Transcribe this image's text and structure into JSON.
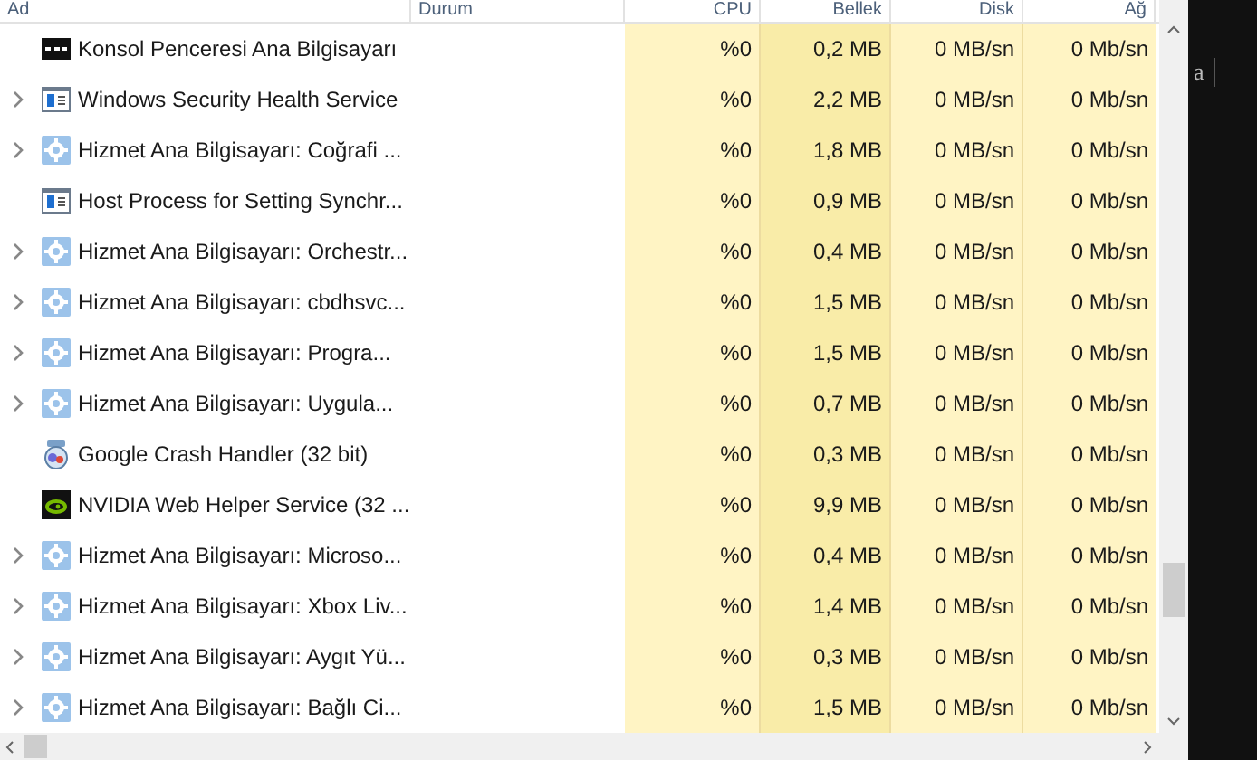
{
  "columns": [
    "Ad",
    "Durum",
    "CPU",
    "Bellek",
    "Disk",
    "Ağ"
  ],
  "rows": [
    {
      "kind": "console",
      "expandable": false,
      "name": "Konsol Penceresi Ana Bilgisayarı",
      "cpu": "%0",
      "memory": "0,2 MB",
      "disk": "0 MB/sn",
      "network": "0 Mb/sn"
    },
    {
      "kind": "window",
      "expandable": true,
      "name": "Windows Security Health Service",
      "cpu": "%0",
      "memory": "2,2 MB",
      "disk": "0 MB/sn",
      "network": "0 Mb/sn"
    },
    {
      "kind": "gear",
      "expandable": true,
      "name": "Hizmet Ana Bilgisayarı: Coğrafi ...",
      "cpu": "%0",
      "memory": "1,8 MB",
      "disk": "0 MB/sn",
      "network": "0 Mb/sn"
    },
    {
      "kind": "window",
      "expandable": false,
      "name": "Host Process for Setting Synchr...",
      "cpu": "%0",
      "memory": "0,9 MB",
      "disk": "0 MB/sn",
      "network": "0 Mb/sn"
    },
    {
      "kind": "gear",
      "expandable": true,
      "name": "Hizmet Ana Bilgisayarı: Orchestr...",
      "cpu": "%0",
      "memory": "0,4 MB",
      "disk": "0 MB/sn",
      "network": "0 Mb/sn"
    },
    {
      "kind": "gear",
      "expandable": true,
      "name": "Hizmet Ana Bilgisayarı: cbdhsvc...",
      "cpu": "%0",
      "memory": "1,5 MB",
      "disk": "0 MB/sn",
      "network": "0 Mb/sn"
    },
    {
      "kind": "gear",
      "expandable": true,
      "name": "Hizmet Ana Bilgisayarı: Progra...",
      "cpu": "%0",
      "memory": "1,5 MB",
      "disk": "0 MB/sn",
      "network": "0 Mb/sn"
    },
    {
      "kind": "gear",
      "expandable": true,
      "name": "Hizmet Ana Bilgisayarı: Uygula...",
      "cpu": "%0",
      "memory": "0,7 MB",
      "disk": "0 MB/sn",
      "network": "0 Mb/sn"
    },
    {
      "kind": "crash",
      "expandable": false,
      "name": "Google Crash Handler (32 bit)",
      "cpu": "%0",
      "memory": "0,3 MB",
      "disk": "0 MB/sn",
      "network": "0 Mb/sn"
    },
    {
      "kind": "nvidia",
      "expandable": false,
      "name": "NVIDIA Web Helper Service (32 ...",
      "cpu": "%0",
      "memory": "9,9 MB",
      "disk": "0 MB/sn",
      "network": "0 Mb/sn"
    },
    {
      "kind": "gear",
      "expandable": true,
      "name": "Hizmet Ana Bilgisayarı: Microso...",
      "cpu": "%0",
      "memory": "0,4 MB",
      "disk": "0 MB/sn",
      "network": "0 Mb/sn"
    },
    {
      "kind": "gear",
      "expandable": true,
      "name": "Hizmet Ana Bilgisayarı: Xbox Liv...",
      "cpu": "%0",
      "memory": "1,4 MB",
      "disk": "0 MB/sn",
      "network": "0 Mb/sn"
    },
    {
      "kind": "gear",
      "expandable": true,
      "name": "Hizmet Ana Bilgisayarı: Aygıt Yü...",
      "cpu": "%0",
      "memory": "0,3 MB",
      "disk": "0 MB/sn",
      "network": "0 Mb/sn"
    },
    {
      "kind": "gear",
      "expandable": true,
      "name": "Hizmet Ana Bilgisayarı: Bağlı Ci...",
      "cpu": "%0",
      "memory": "1,5 MB",
      "disk": "0 MB/sn",
      "network": "0 Mb/sn"
    }
  ],
  "side_panel_text": "a"
}
